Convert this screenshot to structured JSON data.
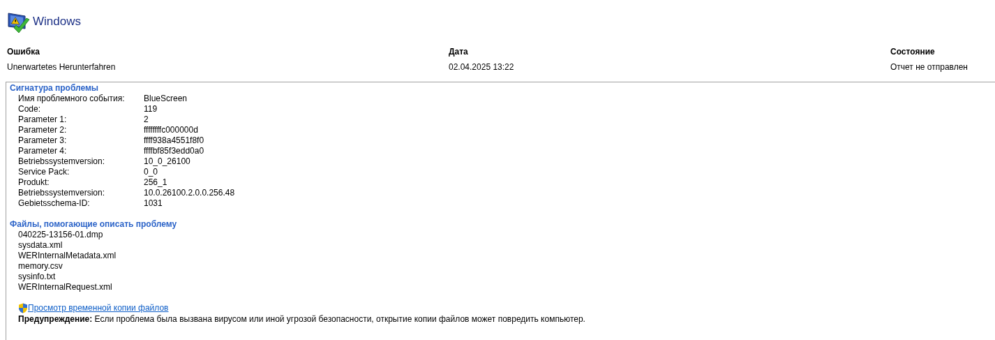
{
  "header": {
    "title": "Windows"
  },
  "summary": [
    {
      "heading": "Ошибка",
      "value": "Unerwartetes Herunterfahren"
    },
    {
      "heading": "Дата",
      "value": "02.04.2025 13:22"
    },
    {
      "heading": "Состояние",
      "value": "Отчет не отправлен"
    }
  ],
  "signature": {
    "title": "Сигнатура проблемы",
    "rows": [
      {
        "label": "Имя проблемного события:",
        "value": "BlueScreen"
      },
      {
        "label": "Code:",
        "value": "119"
      },
      {
        "label": "Parameter 1:",
        "value": "2"
      },
      {
        "label": "Parameter 2:",
        "value": "ffffffffc000000d"
      },
      {
        "label": "Parameter 3:",
        "value": "ffff938a4551f8f0"
      },
      {
        "label": "Parameter 4:",
        "value": "ffffbf85f3edd0a0"
      },
      {
        "label": "Betriebssystemversion:",
        "value": "10_0_26100"
      },
      {
        "label": "Service Pack:",
        "value": "0_0"
      },
      {
        "label": "Produkt:",
        "value": "256_1"
      },
      {
        "label": "Betriebssystemversion:",
        "value": "10.0.26100.2.0.0.256.48"
      },
      {
        "label": "Gebietsschema-ID:",
        "value": "1031"
      }
    ]
  },
  "files": {
    "title": "Файлы, помогающие описать проблему",
    "items": [
      "040225-13156-01.dmp",
      "sysdata.xml",
      "WERInternalMetadata.xml",
      "memory.csv",
      "sysinfo.txt",
      "WERInternalRequest.xml"
    ]
  },
  "link": "Просмотр временной копии файлов",
  "warning": "**Предупреждение:** Если проблема была вызвана вирусом или иной угрозой безопасности, открытие копии файлов может повредить компьютер."
}
